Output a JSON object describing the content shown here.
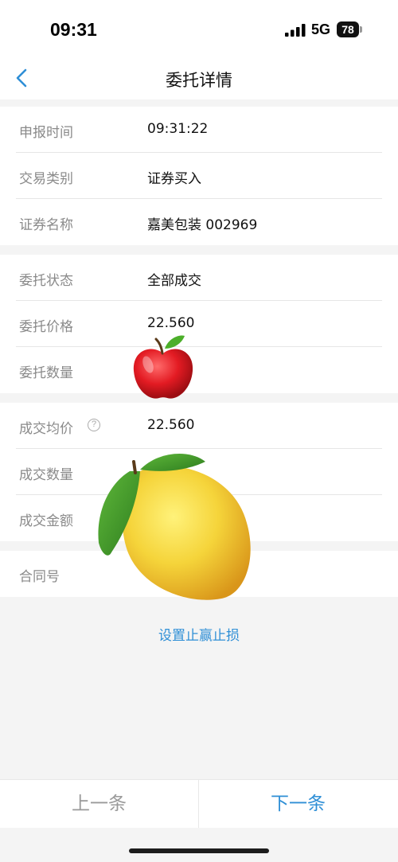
{
  "status_bar": {
    "time": "09:31",
    "network": "5G",
    "battery": "78"
  },
  "nav": {
    "title": "委托详情"
  },
  "section1": {
    "rows": [
      {
        "label": "申报时间",
        "value": "09:31:22"
      },
      {
        "label": "交易类别",
        "value": "证券买入"
      },
      {
        "label": "证券名称",
        "value": "嘉美包装 002969"
      }
    ]
  },
  "section2": {
    "rows": [
      {
        "label": "委托状态",
        "value": "全部成交"
      },
      {
        "label": "委托价格",
        "value": "22.560"
      },
      {
        "label": "委托数量",
        "value": ""
      }
    ]
  },
  "section3": {
    "rows": [
      {
        "label": "成交均价",
        "value": "22.560"
      },
      {
        "label": "成交数量",
        "value": ""
      },
      {
        "label": "成交金额",
        "value": ""
      }
    ]
  },
  "section4": {
    "rows": [
      {
        "label": "合同号",
        "value": ""
      }
    ]
  },
  "link": {
    "set_stop": "设置止赢止损"
  },
  "footer": {
    "prev_label": "上一条",
    "next_label": "下一条"
  },
  "colors": {
    "accent": "#2f8fd6",
    "label_gray": "#8a8a8a",
    "background": "#f4f4f4"
  },
  "icons": {
    "back": "chevron-left-icon",
    "help": "question-circle-icon",
    "overlay_1": "apple-emoji",
    "overlay_2": "lemon-emoji"
  }
}
